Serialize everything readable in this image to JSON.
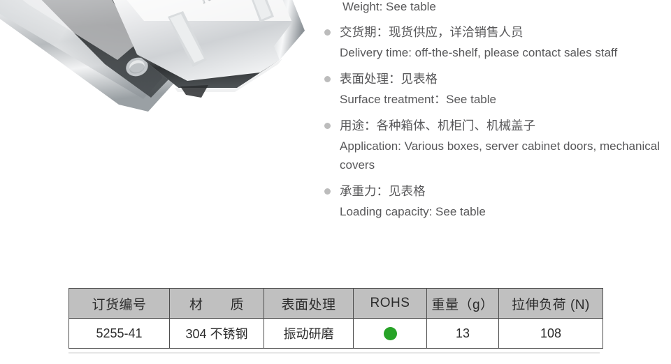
{
  "product_image": {
    "alt": "stainless steel toggle latch hasp",
    "brand_mark": "NRH"
  },
  "specs": {
    "intro_line": "Weight: See table",
    "items": [
      {
        "cn": "交货期：现货供应，详洽销售人员",
        "en": "Delivery time: off-the-shelf, please contact sales staff"
      },
      {
        "cn": "表面处理：见表格",
        "en": "Surface treatment：See table"
      },
      {
        "cn": "用途：各种箱体、机柜门、机械盖子",
        "en": "Application: Various boxes, server cabinet doors, mechanical covers"
      },
      {
        "cn": "承重力：见表格",
        "en": "Loading capacity: See table"
      }
    ]
  },
  "table": {
    "headers": [
      "订货编号",
      "材　　质",
      "表面处理",
      "ROHS",
      "重量（g）",
      "拉伸负荷 (N)"
    ],
    "rows": [
      {
        "order_no": "5255-41",
        "material": "304 不锈钢",
        "surface": "振动研磨",
        "rohs": "",
        "weight": "13",
        "tensile_load": "108"
      }
    ]
  },
  "colors": {
    "header_fill": "#c0c0c0",
    "border": "#4e4e4e",
    "rohs_green": "#27a327",
    "bullet_gray": "#bcbcbc",
    "text_gray": "#58585a"
  }
}
